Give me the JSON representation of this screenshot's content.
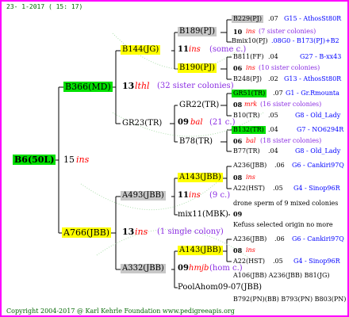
{
  "header_date": "23- 1-2017 ( 15: 17)",
  "footer": "Copyright 2004-2017 @ Karl Kehrle Foundation   www.pedigreeapis.org",
  "root": {
    "id": "B6(50L)",
    "num": "15",
    "ins": "ins"
  },
  "gen1": {
    "top": {
      "id": "B366(MD)",
      "num": "13",
      "lthl": "lthl",
      "sis": "(32 sister colonies)"
    },
    "bot": {
      "id": "A766(JBB)",
      "num": "13",
      "ins": "ins",
      "sis": "(1 single colony)"
    }
  },
  "gen2": {
    "a": {
      "id": "B144(JG)",
      "num": "11",
      "ins": "ins",
      "sis": "(some c.)"
    },
    "b": {
      "id": "GR23(TR)",
      "num": "09",
      "bal": "bal",
      "sis": "(21 c.)"
    },
    "c": {
      "id": "A493(JBB)",
      "num": "11",
      "ins": "ins",
      "sis": "(9 c.)"
    },
    "d": {
      "id": "A332(JBB)",
      "num": "09",
      "hmjb": "hmjb",
      "sis": "(hom c.)"
    }
  },
  "gen3": {
    "a1": "B189(PJ)",
    "a2": "B190(PJ)",
    "b1": "GR22(TR)",
    "b2": "B78(TR)",
    "c1": "A143(JBB)",
    "c2": "mix11(MBK)",
    "d1": "A143(JBB)",
    "d2": "PoolAhom09-07(JBB)"
  },
  "right": {
    "r1": {
      "id": "B229(PJ)",
      "v": ".07",
      "loc": "G15 - AthosSt80R"
    },
    "r2": {
      "num": "10",
      "ins": "ins",
      "sis": "(7 sister colonies)"
    },
    "r3": {
      "id": "Bmix10(PJ)",
      "v": ".08G0 - B173(PJ)+B2"
    },
    "r4": {
      "id": "B811(FF)",
      "v": ".04",
      "loc": "G27 - B-xx43"
    },
    "r5": {
      "num": "06",
      "ins": "ins",
      "sis": "(10 sister colonies)"
    },
    "r6": {
      "id": "B248(PJ)",
      "v": ".02",
      "loc": "G13 - AthosSt80R"
    },
    "r7": {
      "id": "GR51(TR)",
      "v": ".07",
      "loc": "G1 - Gr.Rmounta"
    },
    "r8": {
      "num": "08",
      "ins": "mrk",
      "sis": "(16 sister colonies)"
    },
    "r9": {
      "id": "B10(TR)",
      "v": ".05",
      "loc": "G8 - Old_Lady"
    },
    "r10": {
      "id": "B132(TR)",
      "v": ".04",
      "loc": "G7 - NO6294R"
    },
    "r11": {
      "num": "06",
      "ins": "bal",
      "sis": "(18 sister colonies)"
    },
    "r12": {
      "id": "B77(TR)",
      "v": ".04",
      "loc": "G8 - Old_Lady"
    },
    "r13": {
      "id": "A236(JBB)",
      "v": ".06",
      "loc": "G6 - Cankiri97Q"
    },
    "r14": {
      "num": "08",
      "ins": "ins"
    },
    "r15": {
      "id": "A22(HST)",
      "v": ".05",
      "loc": "G4 - Sinop96R"
    },
    "r16": {
      "text": "drone sperm of 9 mixed colonies"
    },
    "r17": {
      "num": "09"
    },
    "r18": {
      "text": "Kefuss selected origin no more"
    },
    "r19": {
      "id": "A236(JBB)",
      "v": ".06",
      "loc": "G6 - Cankiri97Q"
    },
    "r20": {
      "num": "08",
      "ins": "ins"
    },
    "r21": {
      "id": "A22(HST)",
      "v": ".05",
      "loc": "G4 - Sinop96R"
    },
    "r22": {
      "text": "A106(JBB) A236(JBB) B81(JG)"
    },
    "r23": {
      "text": "B792(PN)(BB) B793(PN) B803(PN)"
    }
  }
}
